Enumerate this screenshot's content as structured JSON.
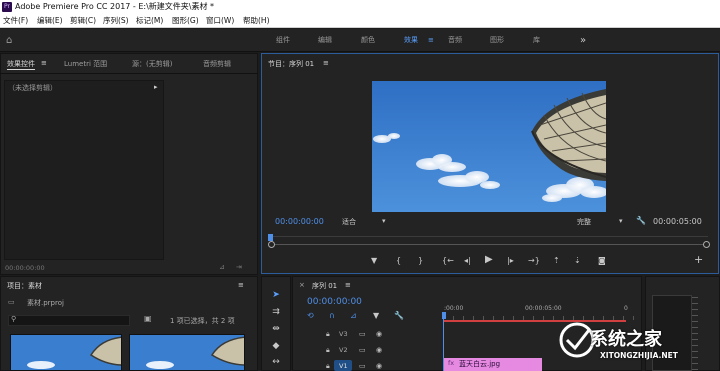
{
  "titlebar": {
    "logo_label": "Pr",
    "title": "Adobe Premiere Pro CC 2017 - E:\\新建文件夹\\素材 *"
  },
  "menu": [
    "文件(F)",
    "编辑(E)",
    "剪辑(C)",
    "序列(S)",
    "标记(M)",
    "图形(G)",
    "窗口(W)",
    "帮助(H)"
  ],
  "workspaces": {
    "items": [
      "组件",
      "编辑",
      "颜色",
      "效果",
      "音频",
      "图形",
      "库"
    ],
    "active": "效果",
    "overflow_label": "»",
    "home_label": "⌂"
  },
  "effect_controls": {
    "tabs": [
      "效果控件",
      "Lumetri 范围",
      "源：(无剪辑)",
      "音频剪辑"
    ],
    "menu_glyph": "≡",
    "empty_text": "（未选择剪辑）",
    "bottom_timecode": "00:00:00:00"
  },
  "program_monitor": {
    "title": "节目：序列 01",
    "menu_glyph": "≡",
    "timecode_current": "00:00:00:00",
    "fit": "适合",
    "quality": "完整",
    "timecode_duration": "00:00:05:00"
  },
  "project": {
    "title": "项目：素材",
    "menu_glyph": "≡",
    "file_name": "素材.prproj",
    "selection_status": "1 项已选择，共 2 项",
    "search_placeholder": ""
  },
  "timeline": {
    "title": "序列 01",
    "menu_glyph": "≡",
    "timecode": "00:00:00:00",
    "ruler": [
      ":00:00",
      "00:00:05:00"
    ],
    "tracks": [
      "V3",
      "V2",
      "V1"
    ],
    "clip_name": "蓝天白云.jpg"
  },
  "watermark": {
    "brand": "系统之家",
    "url": "XITONGZHIJIA.NET"
  },
  "colors": {
    "accent": "#4f8fe8",
    "monitor_border": "#2c5c9a",
    "clip": "#e58ae0",
    "in_out_bar": "#d04040"
  }
}
